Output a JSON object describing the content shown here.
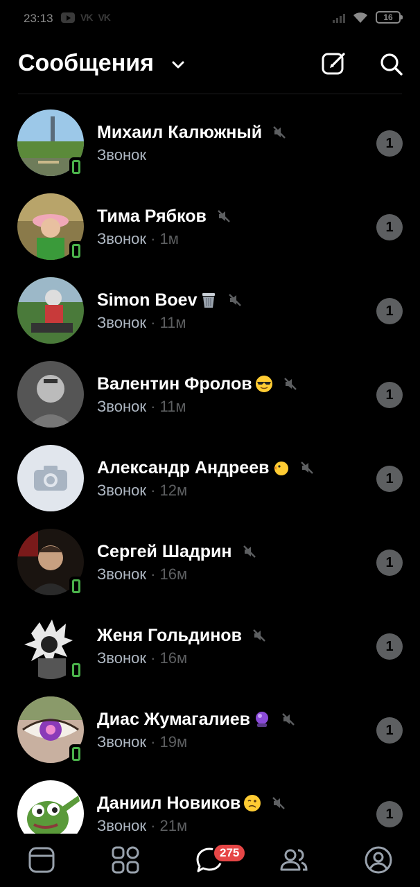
{
  "status_bar": {
    "time": "23:13",
    "left_icons": [
      "youtube-icon",
      "vk-icon",
      "vk-icon"
    ],
    "vk_label": "VK",
    "battery": "16"
  },
  "header": {
    "title": "Сообщения",
    "icons": [
      "chevron-down-icon",
      "compose-icon",
      "search-icon"
    ]
  },
  "chats": [
    {
      "name": "Михаил Калюжный",
      "emoji": "",
      "muted": true,
      "call": "Звонок",
      "time": "",
      "unread": "1",
      "online": true
    },
    {
      "name": "Тима Рябков",
      "emoji": "",
      "muted": true,
      "call": "Звонок",
      "time": " · 1м",
      "unread": "1",
      "online": true
    },
    {
      "name": "Simon Boev",
      "emoji": "wastebasket",
      "muted": true,
      "call": "Звонок",
      "time": " · 11м",
      "unread": "1",
      "online": false
    },
    {
      "name": "Валентин Фролов",
      "emoji": "sunglasses",
      "muted": true,
      "call": "Звонок",
      "time": " · 11м",
      "unread": "1",
      "online": false
    },
    {
      "name": "Александр Андреев",
      "emoji": "chick",
      "muted": true,
      "call": "Звонок",
      "time": " · 12м",
      "unread": "1",
      "online": false
    },
    {
      "name": "Сергей Шадрин",
      "emoji": "",
      "muted": true,
      "call": "Звонок",
      "time": " · 16м",
      "unread": "1",
      "online": true
    },
    {
      "name": "Женя Гольдинов",
      "emoji": "",
      "muted": true,
      "call": "Звонок",
      "time": " · 16м",
      "unread": "1",
      "online": true
    },
    {
      "name": "Диас Жумагалиев",
      "emoji": "crystal-ball",
      "muted": true,
      "call": "Звонок",
      "time": " · 19м",
      "unread": "1",
      "online": true
    },
    {
      "name": "Даниил Новиков",
      "emoji": "woozy-face",
      "muted": true,
      "call": "Звонок",
      "time": " · 21м",
      "unread": "1",
      "online": false
    }
  ],
  "tab_bar": {
    "tabs": [
      "feed-icon",
      "services-icon",
      "messages-icon",
      "friends-icon",
      "profile-icon"
    ],
    "active": "messages-icon",
    "messages_badge": "275"
  },
  "colors": {
    "background": "#000000",
    "online": "#4bb34b",
    "badge": "#e64646",
    "unread_counter": "#5d5f61"
  }
}
